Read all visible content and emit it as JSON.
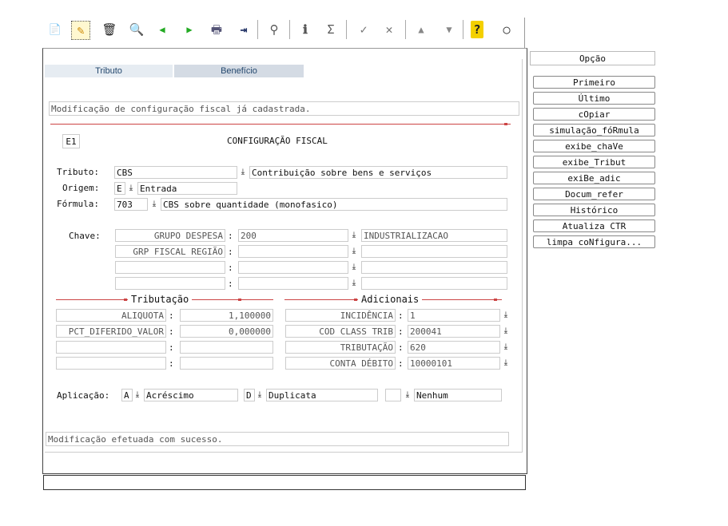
{
  "toolbar": {
    "new_icon": "📄",
    "edit_icon": "✎",
    "delete_icon": "🗑",
    "search_icon": "🔍",
    "back_icon": "◀",
    "forward_icon": "▶",
    "print_icon": "🖶",
    "exit_icon": "⇥",
    "binoculars_icon": "⚲",
    "info_icon": "ℹ",
    "sum_icon": "Σ",
    "check_icon": "✓",
    "tools_icon": "✕",
    "up_icon": "▲",
    "down_icon": "▼",
    "help_icon": "?",
    "chat_icon": "○"
  },
  "tabs": [
    {
      "label": "Tributo"
    },
    {
      "label": "Benefício"
    }
  ],
  "message_top": "Modificação de configuração fiscal já cadastrada.",
  "header": {
    "code": "E1",
    "title": "CONFIGURAÇÃO FISCAL"
  },
  "fields": {
    "tributo": {
      "label": "Tributo:",
      "code": "CBS",
      "desc": "Contribuição sobre bens e serviços"
    },
    "origem": {
      "label": "Origem:",
      "code": "E",
      "desc": "Entrada"
    },
    "formula": {
      "label": "Fórmula:",
      "code": "703",
      "desc": "CBS sobre quantidade (monofasico)"
    }
  },
  "chave": {
    "label": "Chave:",
    "rows": [
      {
        "name": "GRUPO DESPESA",
        "value": "200",
        "desc": "INDUSTRIALIZACAO"
      },
      {
        "name": "GRP FISCAL REGIÃO",
        "value": "",
        "desc": ""
      },
      {
        "name": "",
        "value": "",
        "desc": ""
      },
      {
        "name": "",
        "value": "",
        "desc": ""
      }
    ]
  },
  "tributacao": {
    "title": "Tributação",
    "rows": [
      {
        "name": "ALIQUOTA",
        "value": "1,100000"
      },
      {
        "name": "PCT_DIFERIDO_VALOR",
        "value": "0,000000"
      },
      {
        "name": "",
        "value": ""
      },
      {
        "name": "",
        "value": ""
      }
    ]
  },
  "adicionais": {
    "title": "Adicionais",
    "rows": [
      {
        "name": "INCIDÊNCIA",
        "value": "1"
      },
      {
        "name": "COD CLASS TRIB",
        "value": "200041"
      },
      {
        "name": "TRIBUTAÇÃO",
        "value": "620"
      },
      {
        "name": "CONTA DÉBITO",
        "value": "10000101"
      }
    ]
  },
  "aplicacao": {
    "label": "Aplicação:",
    "items": [
      {
        "code": "A",
        "desc": "Acréscimo"
      },
      {
        "code": "D",
        "desc": "Duplicata"
      },
      {
        "code": "",
        "desc": "Nenhum"
      }
    ]
  },
  "message_bottom": "Modificação efetuada com sucesso.",
  "colon": ":",
  "side": {
    "header": "Opção",
    "buttons": [
      "Primeiro",
      "Último",
      "cOpiar",
      "simulação_fóRmula",
      "exibe_chaVe",
      "exibe_Tribut",
      "exiBe_adic",
      "Docum_refer",
      "Histórico",
      "Atualiza CTR",
      "limpa coNfigura..."
    ]
  }
}
